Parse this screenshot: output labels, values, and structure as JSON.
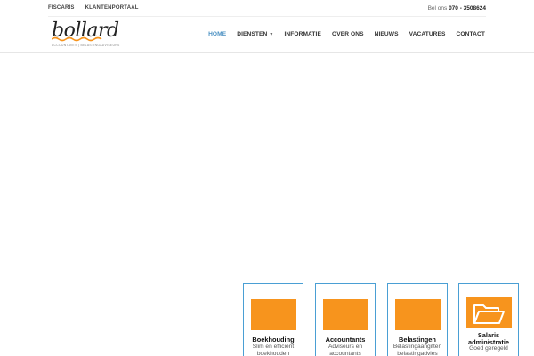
{
  "topbar": {
    "links": [
      "FISCARIS",
      "KLANTENPORTAAL"
    ],
    "phone_label": "Bel ons",
    "phone_number": "070 - 3508624"
  },
  "logo": {
    "word": "bollard",
    "tagline": "ACCOUNTANTS | BELASTINGADVISEURS"
  },
  "nav": {
    "items": [
      {
        "label": "HOME",
        "active": true
      },
      {
        "label": "DIENSTEN",
        "has_dropdown": true
      },
      {
        "label": "INFORMATIE"
      },
      {
        "label": "OVER ONS"
      },
      {
        "label": "NIEUWS"
      },
      {
        "label": "VACATURES"
      },
      {
        "label": "CONTACT"
      }
    ]
  },
  "services": [
    {
      "title": "Boekhouding",
      "line1": "Slim en efficiënt",
      "line2": "boekhouden"
    },
    {
      "title": "Accountants",
      "line1": "Adviseurs en",
      "line2": "accountants"
    },
    {
      "title": "Belastingen",
      "line1": "Belastingaangiften",
      "line2": "belastingadvies"
    },
    {
      "title_line1": "Salaris",
      "title_line2": "administratie",
      "line1": "Goed geregeld",
      "icon": "folder-icon"
    }
  ],
  "colors": {
    "accent_orange": "#f7941d",
    "accent_blue": "#4a9fd4",
    "nav_active": "#4a90c2"
  }
}
